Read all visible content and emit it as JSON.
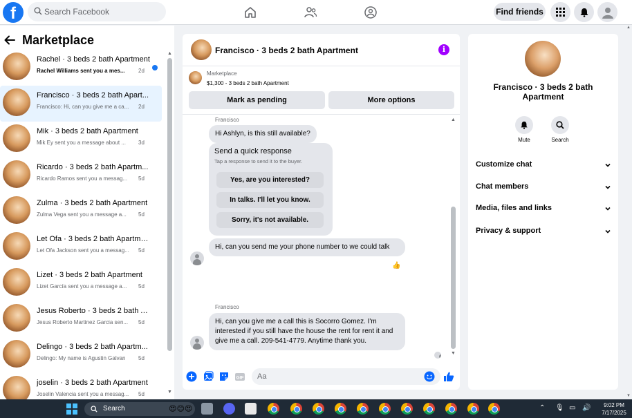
{
  "topbar": {
    "logo_letter": "f",
    "search_placeholder": "Search Facebook",
    "find_friends_label": "Find friends"
  },
  "sidebar": {
    "title": "Marketplace",
    "conversations": [
      {
        "name": "Rachel · 3 beds 2 bath Apartment",
        "preview": "Rachel Williams sent you a mes...",
        "time": "2d",
        "unread": true
      },
      {
        "name": "Francisco · 3 beds 2 bath Apart...",
        "preview": "Francisco: Hi, can you give me a ca...",
        "time": "2d",
        "active": true
      },
      {
        "name": "Mik · 3 beds 2 bath Apartment",
        "preview": "Mik Ey sent you a message about ...",
        "time": "3d"
      },
      {
        "name": "Ricardo · 3 beds 2 bath Apartm...",
        "preview": "Ricardo Ramos sent you a messag...",
        "time": "5d"
      },
      {
        "name": "Zulma · 3 beds 2 bath Apartment",
        "preview": "Zulma Vega sent you a message a...",
        "time": "5d"
      },
      {
        "name": "Let Ofa · 3 beds 2 bath Apartme...",
        "preview": "Let Ofa Jackson sent you a messag...",
        "time": "5d"
      },
      {
        "name": "Lizet · 3 beds 2 bath Apartment",
        "preview": "Lizet García sent you a message a...",
        "time": "5d"
      },
      {
        "name": "Jesus Roberto · 3 beds 2 bath A...",
        "preview": "Jesus Roberto Martinez Garcia sen...",
        "time": "5d"
      },
      {
        "name": "Delingo · 3 beds 2 bath Apartm...",
        "preview": "Delingo: My name is Agustin Galvan",
        "time": "5d"
      },
      {
        "name": "joselin · 3 beds 2 bath Apartment",
        "preview": "Joselin Valencia sent you a messag...",
        "time": "5d"
      }
    ]
  },
  "chat": {
    "title": "Francisco · 3 beds 2 bath Apartment",
    "info_glyph": "i",
    "listing_label": "Marketplace",
    "listing_price": "$1,300 - 3 beds 2 bath Apartment",
    "mark_pending_label": "Mark as pending",
    "more_options_label": "More options",
    "sender_name_1": "Francisco",
    "message_1": "Hi Ashlyn, is this still available?",
    "quick_title": "Send a quick response",
    "quick_subtitle": "Tap a response to send it to the buyer.",
    "quick_responses": [
      "Yes, are you interested?",
      "In talks. I'll let you know.",
      "Sorry, it's not available."
    ],
    "message_2": "Hi, can you send me your phone number to we could talk",
    "sender_name_2": "Francisco",
    "message_3": "Hi, can you give me a call this is Socorro Gomez. I'm interested if you still have the house the rent for rent it and give me a call. 209-541-4779. Anytime thank you.",
    "composer_placeholder": "Aa"
  },
  "rpanel": {
    "name": "Francisco · 3 beds 2 bath Apartment",
    "mute_label": "Mute",
    "search_label": "Search",
    "rows": [
      "Customize chat",
      "Chat members",
      "Media, files and links",
      "Privacy & support"
    ]
  },
  "taskbar": {
    "search_label": "Search",
    "time": "9:02 PM",
    "date": "7/17/2025"
  },
  "colors": {
    "brand": "#1877f2",
    "info": "#a100ff"
  }
}
